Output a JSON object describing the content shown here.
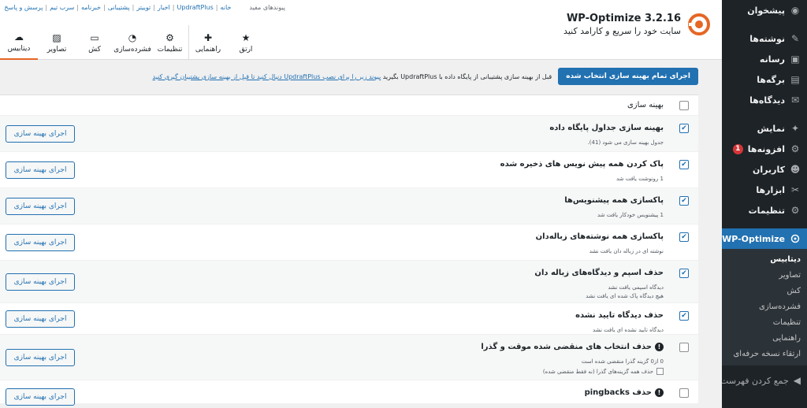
{
  "admin_menu": {
    "items": [
      {
        "label": "پیشخوان",
        "icon": "dashboard-icon"
      },
      {
        "label": "نوشته‌ها",
        "icon": "pin-icon"
      },
      {
        "label": "رسانه",
        "icon": "media-icon"
      },
      {
        "label": "برگه‌ها",
        "icon": "pages-icon"
      },
      {
        "label": "دیدگاه‌ها",
        "icon": "comments-icon"
      },
      {
        "label": "نمایش",
        "icon": "appearance-icon"
      },
      {
        "label": "افزونه‌ها",
        "icon": "plugins-icon",
        "badge": "1"
      },
      {
        "label": "کاربران",
        "icon": "users-icon"
      },
      {
        "label": "ابزارها",
        "icon": "tools-icon"
      },
      {
        "label": "تنظیمات",
        "icon": "settings-icon"
      }
    ],
    "active": {
      "label": "WP-Optimize",
      "icon": "wp-optimize-icon"
    },
    "submenu": [
      "دیتابیس",
      "تصاویر",
      "کش",
      "فشرده‌سازی",
      "تنظیمات",
      "راهنمایی",
      "ارتقاء نسخه حرفه‌ای"
    ],
    "collapse_label": "جمع کردن فهرست"
  },
  "header": {
    "top_links_label": "پیوندهای مفید",
    "top_links": [
      "خانه",
      "UpdraftPlus",
      "اخبار",
      "توییتر",
      "پشتیبانی",
      "خبرنامه",
      "سرب تیم",
      "پرسش و پاسخ"
    ],
    "brand_title": "WP-Optimize 3.2.16",
    "brand_tagline": "سایت خود را سریع و کارامد کنید",
    "tabs": [
      {
        "label": "دیتابیس",
        "icon": "database-icon",
        "active": true
      },
      {
        "label": "تصاویر",
        "icon": "images-icon"
      },
      {
        "label": "کش",
        "icon": "cache-icon"
      },
      {
        "label": "فشرده‌سازی",
        "icon": "minify-icon"
      },
      {
        "label": "تنظیمات",
        "icon": "settings-icon"
      },
      {
        "label": "راهنمایی",
        "icon": "help-icon"
      },
      {
        "label": "ارتق",
        "icon": "premium-icon"
      }
    ]
  },
  "notice": {
    "run_all_label": "اجرای تمام بهینه سازی انتخاب شده",
    "text": "قبل از بهینه سازی پشتیبانی از پایگاه داده با UpdraftPlus بگیرید",
    "link": "پیوند زیر را برای نصب UpdraftPlus دنبال کنید تا قبل از بهینه سازی پشتیبان گیری کنید"
  },
  "table": {
    "header_label": "بهینه سازی",
    "run_label": "اجرای بهینه سازی",
    "rows": [
      {
        "title": "بهینه سازی جداول پایگاه داده",
        "checked": true,
        "desc": [
          "جدول بهینه سازی می شود (41)."
        ]
      },
      {
        "title": "پاک کردن همه پیش نویس های ذخیره شده",
        "checked": true,
        "desc": [
          "1 رونوشت یافت شد"
        ]
      },
      {
        "title": "پاکسازی همه پیشنویس‌ها",
        "checked": true,
        "desc": [
          "1 پیشنویس خودکار یافت شد"
        ]
      },
      {
        "title": "پاکسازی همه نوشته‌های زباله‌دان",
        "checked": true,
        "desc": [
          "نوشته ای در زباله دان یافت نشد"
        ]
      },
      {
        "title": "حذف اسپم و دیدگاه‌های زباله دان",
        "checked": true,
        "desc": [
          "دیدگاه اسپمی یافت نشد",
          "هیچ دیدگاه پاک شده ای یافت نشد"
        ]
      },
      {
        "title": "حذف دیدگاه تایید نشده",
        "checked": true,
        "desc": [
          "دیدگاه تایید نشده ای یافت نشد"
        ]
      },
      {
        "title": "حذف انتخاب های منقضی شده موقت و گذرا",
        "checked": false,
        "warn": true,
        "desc": [
          "0 از0 گزینه گذرا منقضی شده است"
        ],
        "sub_checkbox": "حذف همه گزینه‌های گذرا (نه فقط منقضی شده)"
      },
      {
        "title": "حذف pingbacks",
        "checked": false,
        "warn": true,
        "desc": []
      }
    ]
  }
}
